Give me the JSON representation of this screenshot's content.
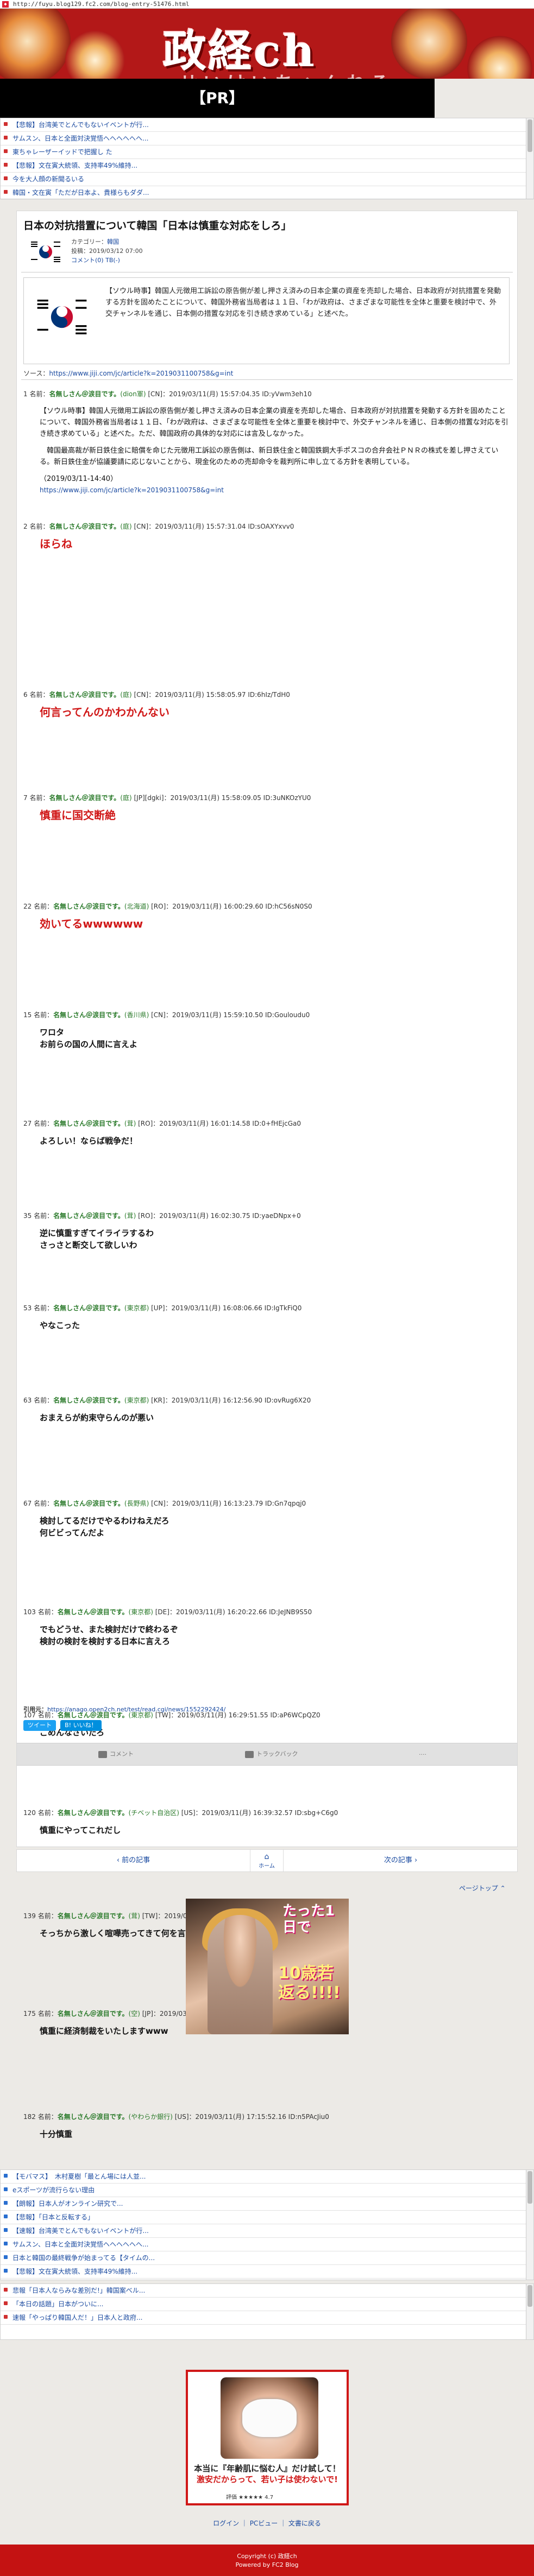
{
  "address_bar": {
    "url": "http://fuyu.blog129.fc2.com/blog-entry-51476.html"
  },
  "header": {
    "title": "政経ch",
    "subtitle": "せいけいちゃんねる"
  },
  "pr_label": "【PR】",
  "top_links": [
    "【悲報】台湾美でとんでもないイベントが行...",
    "サムスン、日本と全面対決覚悟ヘヘヘヘヘヘ...",
    "東ちゃレーザーイッドで把握し た",
    "【悲報】文在寅大統領、支持率49%維持...",
    "今を大人顔の新聞るいる",
    "韓国・文在寅「ただが日本よ、貴様らもダダ..."
  ],
  "article": {
    "title": "日本の対抗措置について韓国「日本は慎重な対応をしろ」",
    "category_label": "カテゴリー：",
    "category": "韓国",
    "posted_label": "投稿：",
    "posted": "2019/03/12 07:00",
    "comments_label": "コメント(0)",
    "trackback": "TB(-)",
    "lead_text": "【ソウル時事】韓国人元徴用工訴訟の原告側が差し押さえ済みの日本企業の資産を売却した場合、日本政府が対抗措置を発動する方針を固めたことについて、韓国外務省当局者は１１日、「わが政府は、さまざまな可能性を全体と重要を検討中で、外交チャンネルを通じ、日本側の措置な対応を引き続き求めている」と述べた。",
    "source_prefix": "ソース：",
    "source_url": "https://www.jiji.com/jc/article?k=2019031100758&g=int",
    "first_post": {
      "num": "1",
      "name": "名無しさん＠涙目です。",
      "loc": "(dion軍)",
      "id": "[CN]",
      "time": "2019/03/11(月) 15:57:04.35 ID:yVwm3eh10",
      "p1": "【ソウル時事】韓国人元徴用工訴訟の原告側が差し押さえ済みの日本企業の資産を売却した場合、日本政府が対抗措置を発動する方針を固めたことについて、韓国外務省当局者は１１日、「わが政府は、さまざまな可能性を全体と重要を検討中で、外交チャンネルを通じ、日本側の措置な対応を引き続き求めている」と述べた。ただ、韓国政府の具体的な対応には言及しなかった。",
      "p2": "　韓国最高裁が新日鉄住金に賠償を命じた元徴用工訴訟の原告側は、新日鉄住金と韓国鉄鋼大手ポスコの合弁会社ＰＮＲの株式を差し押さえている。新日鉄住金が協議要請に応じないことから、現金化のための売却命令を裁判所に申し立てる方針を表明している。",
      "date": "（2019/03/11-14:40）",
      "url": "https://www.jiji.com/jc/article?k=2019031100758&g=int"
    },
    "responses": [
      {
        "num": "2",
        "name": "名無しさん＠涙目です。",
        "loc": "(庭)",
        "id": "[CN]",
        "time": "2019/03/11(月) 15:57:31.04 ID:sOAXYxvv0",
        "body": "ほらね",
        "style": "red"
      },
      {
        "num": "6",
        "name": "名無しさん＠涙目です。",
        "loc": "(庭)",
        "id": "[CN]",
        "time": "2019/03/11(月) 15:58:05.97 ID:6hIz/TdH0",
        "body": "何言ってんのかわかんない",
        "style": "red"
      },
      {
        "num": "7",
        "name": "名無しさん＠涙目です。",
        "loc": "(庭)",
        "id": "[JP][dgki]",
        "time": "2019/03/11(月) 15:58:09.05 ID:3uNKOzYU0",
        "body": "慎重に国交断絶",
        "style": "red"
      },
      {
        "num": "22",
        "name": "名無しさん＠涙目です。",
        "loc": "(北海道)",
        "id": "[RO]",
        "time": "2019/03/11(月) 16:00:29.60 ID:hC56sN0S0",
        "body": "効いてるwwwwww",
        "style": "red"
      },
      {
        "num": "15",
        "name": "名無しさん＠涙目です。",
        "loc": "(香川県)",
        "id": "[CN]",
        "time": "2019/03/11(月) 15:59:10.50 ID:Gouloudu0",
        "body": "ワロタ\nお前らの国の人間に言えよ",
        "style": "black"
      },
      {
        "num": "27",
        "name": "名無しさん＠涙目です。",
        "loc": "(茸)",
        "id": "[RO]",
        "time": "2019/03/11(月) 16:01:14.58 ID:0+fHEjcGa0",
        "body": "よろしい！ならば戦争だ！",
        "style": "black"
      },
      {
        "num": "35",
        "name": "名無しさん＠涙目です。",
        "loc": "(茸)",
        "id": "[RO]",
        "time": "2019/03/11(月) 16:02:30.75 ID:yaeDNpx+0",
        "body": "逆に慎重すぎてイライラするわ\nさっさと断交して欲しいわ",
        "style": "black"
      },
      {
        "num": "53",
        "name": "名無しさん＠涙目です。",
        "loc": "(東京都)",
        "id": "[UP]",
        "time": "2019/03/11(月) 16:08:06.66 ID:IgTkFiQ0",
        "body": "やなこった",
        "style": "black"
      },
      {
        "num": "63",
        "name": "名無しさん＠涙目です。",
        "loc": "(東京都)",
        "id": "[KR]",
        "time": "2019/03/11(月) 16:12:56.90 ID:ovRug6X20",
        "body": "おまえらが約束守らんのが悪い",
        "style": "black"
      },
      {
        "num": "67",
        "name": "名無しさん＠涙目です。",
        "loc": "(長野県)",
        "id": "[CN]",
        "time": "2019/03/11(月) 16:13:23.79 ID:Gn7qpqj0",
        "body": "検討してるだけでやるわけねえだろ\n何ビビってんだよ",
        "style": "black"
      },
      {
        "num": "103",
        "name": "名無しさん＠涙目です。",
        "loc": "(東京都)",
        "id": "[DE]",
        "time": "2019/03/11(月) 16:20:22.66 ID:JeJNB9S50",
        "body": "でもどうせ、また検討だけで終わるぞ\n検討の検討を検討する日本に言えろ",
        "style": "black"
      },
      {
        "num": "107",
        "name": "名無しさん＠涙目です。",
        "loc": "(東京都)",
        "id": "[TW]",
        "time": "2019/03/11(月) 16:29:51.55 ID:aP6WCpQZ0",
        "body": "ごめんなさいだろ",
        "style": "black"
      },
      {
        "num": "120",
        "name": "名無しさん＠涙目です。",
        "loc": "(チベット自治区)",
        "id": "[US]",
        "time": "2019/03/11(月) 16:39:32.57 ID:sbg+C6g0",
        "body": "慎重にやってこれだし",
        "style": "black"
      },
      {
        "num": "139",
        "name": "名無しさん＠涙目です。",
        "loc": "(茸)",
        "id": "[TW]",
        "time": "2019/03/11(月) 16:49:49.96 ID:K7v5VFlu0",
        "body": "そっちから激しく喧嘩売ってきて何を言ってるんだ",
        "style": "black"
      },
      {
        "num": "175",
        "name": "名無しさん＠涙目です。",
        "loc": "(空)",
        "id": "[JP]",
        "time": "2019/03/11(月) 17:10:17.82 ID:eRHr/Jrl00",
        "body": "慎重に経済制裁をいたしますwww",
        "style": "black"
      },
      {
        "num": "182",
        "name": "名無しさん＠涙目です。",
        "loc": "(やわらか銀行)",
        "id": "[US]",
        "time": "2019/03/11(月) 17:15:52.16 ID:n5PAcJiu0",
        "body": "十分慎重",
        "style": "black"
      }
    ],
    "ref_prefix": "引用元：",
    "ref_url": "https://anago.open2ch.net/test/read.cgi/news/1552292424/",
    "share_tweet": "ツイート",
    "share_hatena": "B! いいね！",
    "tool_comment": "コメント",
    "tool_trackback": "トラックバック",
    "tool_other": "...."
  },
  "pager": {
    "prev": "前の記事",
    "home": "ホーム",
    "next": "次の記事"
  },
  "pagetop": "ページトップ",
  "ad1": {
    "copy1": "たった1日で",
    "copy2": "10歳若返る!!!!"
  },
  "mid_links": [
    "【モバマス】　木村夏樹「最とん場には人並...",
    "eスポーツが流行らない理由",
    "【朗報】日本人がオンライン研究で...",
    "【悲報】「日本と反転する」",
    "【速報】台湾美でとんでもないイベントが行...",
    "サムスン、日本と全面対決覚悟ヘヘヘヘヘヘ...",
    "日本と韓国の最終戦争が始まってる【タイムの...",
    "【悲報】文在寅大統領、支持率49%維持..."
  ],
  "bottom_links": [
    "悲報「日本人ならみな差別だ!」韓国案べル...",
    "「本日の話題」日本がついに...",
    "速報「やっぱり韓国人だ！」日本人と政府..."
  ],
  "ad2": {
    "line1": "本当に『年齢肌に悩む人』だけ試して！",
    "line2": "激安だからって、若い子は使わないで!",
    "rate": "評価 ★★★★★ 4.7"
  },
  "footer": {
    "links": "ログイン ｜ PCビュー ｜ 文書に戻る",
    "copyright": "Copyright (c) 政経ch",
    "powered": "Powered by FC2 Blog"
  }
}
